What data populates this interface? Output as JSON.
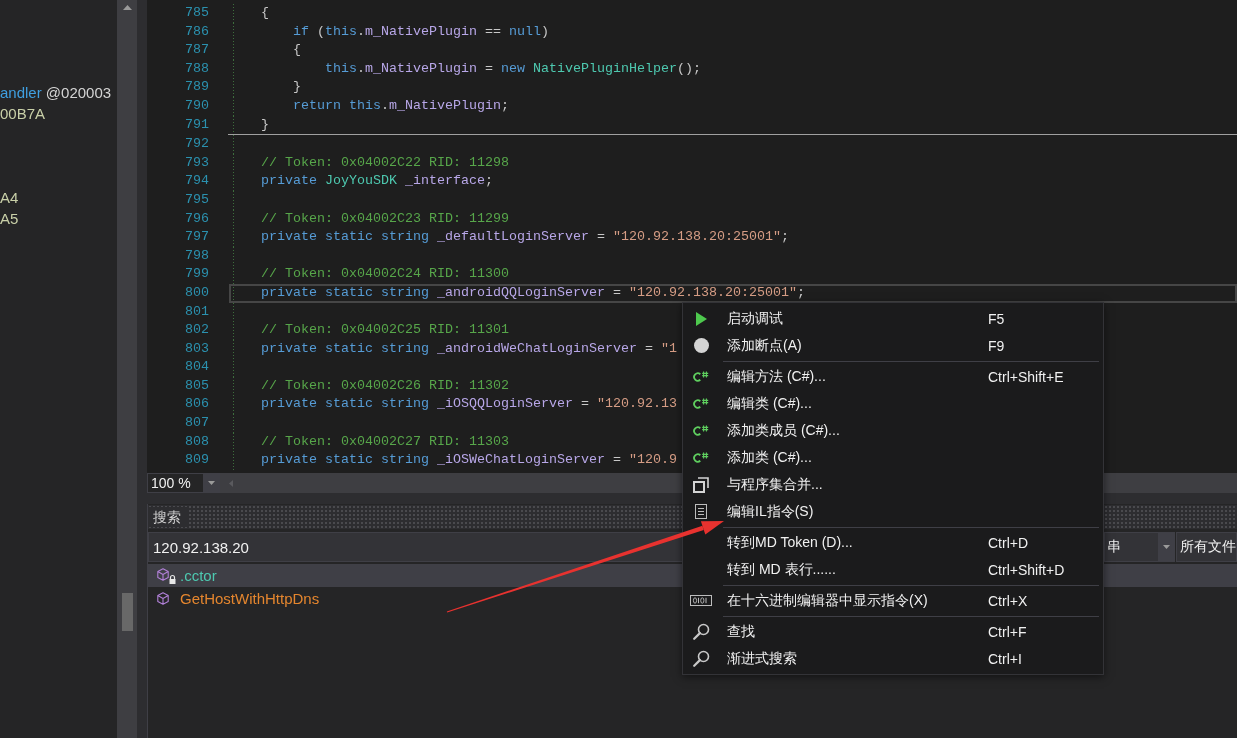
{
  "left_panel": {
    "groups": [
      [
        {
          "tokens": [
            {
              "kind": "name",
              "text": "andler"
            },
            {
              "kind": "plain",
              "text": " @020003"
            }
          ]
        },
        {
          "tokens": [
            {
              "kind": "number",
              "text": "00B7A"
            }
          ]
        }
      ],
      [
        {
          "tokens": [
            {
              "kind": "number",
              "text": "A4"
            }
          ]
        },
        {
          "tokens": [
            {
              "kind": "number",
              "text": "A5"
            }
          ]
        }
      ]
    ]
  },
  "editor": {
    "blocks": [
      [
        {
          "number": "785",
          "current": false,
          "tokens": [
            {
              "kind": "plain",
              "text": "    {"
            }
          ]
        },
        {
          "number": "786",
          "current": false,
          "tokens": [
            {
              "kind": "keyword",
              "text": "        if"
            },
            {
              "kind": "plain",
              "text": " ("
            },
            {
              "kind": "keyword",
              "text": "this"
            },
            {
              "kind": "plain",
              "text": "."
            },
            {
              "kind": "field",
              "text": "m_NativePlugin"
            },
            {
              "kind": "plain",
              "text": " == "
            },
            {
              "kind": "keyword",
              "text": "null"
            },
            {
              "kind": "plain",
              "text": ")"
            }
          ]
        },
        {
          "number": "787",
          "current": false,
          "tokens": [
            {
              "kind": "plain",
              "text": "        {"
            }
          ]
        },
        {
          "number": "788",
          "current": false,
          "tokens": [
            {
              "kind": "keyword",
              "text": "            this"
            },
            {
              "kind": "plain",
              "text": "."
            },
            {
              "kind": "field",
              "text": "m_NativePlugin"
            },
            {
              "kind": "plain",
              "text": " = "
            },
            {
              "kind": "keyword",
              "text": "new "
            },
            {
              "kind": "type",
              "text": "NativePluginHelper"
            },
            {
              "kind": "plain",
              "text": "();"
            }
          ]
        },
        {
          "number": "789",
          "current": false,
          "tokens": [
            {
              "kind": "plain",
              "text": "        }"
            }
          ]
        },
        {
          "number": "790",
          "current": false,
          "tokens": [
            {
              "kind": "keyword",
              "text": "        return this"
            },
            {
              "kind": "plain",
              "text": "."
            },
            {
              "kind": "field",
              "text": "m_NativePlugin"
            },
            {
              "kind": "plain",
              "text": ";"
            }
          ]
        },
        {
          "number": "791",
          "current": false,
          "tokens": [
            {
              "kind": "plain",
              "text": "    }"
            }
          ]
        }
      ],
      [
        {
          "number": "792",
          "current": false
        },
        {
          "number": "793",
          "current": false,
          "tokens": [
            {
              "kind": "comment",
              "text": "    // Token: 0x04002C22 RID: 11298"
            }
          ]
        },
        {
          "number": "794",
          "current": false,
          "tokens": [
            {
              "kind": "keyword",
              "text": "    private "
            },
            {
              "kind": "type",
              "text": "JoyYouSDK "
            },
            {
              "kind": "field",
              "text": "_interface"
            },
            {
              "kind": "plain",
              "text": ";"
            }
          ]
        },
        {
          "number": "795",
          "current": false
        },
        {
          "number": "796",
          "current": false,
          "tokens": [
            {
              "kind": "comment",
              "text": "    // Token: 0x04002C23 RID: 11299"
            }
          ]
        },
        {
          "number": "797",
          "current": false,
          "tokens": [
            {
              "kind": "keyword",
              "text": "    private static string "
            },
            {
              "kind": "field",
              "text": "_defaultLoginServer"
            },
            {
              "kind": "plain",
              "text": " = "
            },
            {
              "kind": "string",
              "text": "\"120.92.138.20:25001\""
            },
            {
              "kind": "plain",
              "text": ";"
            }
          ]
        },
        {
          "number": "798",
          "current": false
        },
        {
          "number": "799",
          "current": false,
          "tokens": [
            {
              "kind": "comment",
              "text": "    // Token: 0x04002C24 RID: 11300"
            }
          ]
        },
        {
          "number": "800",
          "current": true,
          "tokens": [
            {
              "kind": "keyword",
              "text": "    private static string "
            },
            {
              "kind": "field",
              "text": "_androidQQLoginServer"
            },
            {
              "kind": "plain",
              "text": " = "
            },
            {
              "kind": "string",
              "text": "\"120.92.138.20:25001\""
            },
            {
              "kind": "plain",
              "text": ";"
            }
          ]
        },
        {
          "number": "801",
          "current": false
        },
        {
          "number": "802",
          "current": false,
          "tokens": [
            {
              "kind": "comment",
              "text": "    // Token: 0x04002C25 RID: 11301"
            }
          ]
        },
        {
          "number": "803",
          "current": false,
          "tokens": [
            {
              "kind": "keyword",
              "text": "    private static string "
            },
            {
              "kind": "field",
              "text": "_androidWeChatLoginServer"
            },
            {
              "kind": "plain",
              "text": " = "
            },
            {
              "kind": "string",
              "text": "\"1"
            }
          ]
        },
        {
          "number": "804",
          "current": false
        },
        {
          "number": "805",
          "current": false,
          "tokens": [
            {
              "kind": "comment",
              "text": "    // Token: 0x04002C26 RID: 11302"
            }
          ]
        },
        {
          "number": "806",
          "current": false,
          "tokens": [
            {
              "kind": "keyword",
              "text": "    private static string "
            },
            {
              "kind": "field",
              "text": "_iOSQQLoginServer"
            },
            {
              "kind": "plain",
              "text": " = "
            },
            {
              "kind": "string",
              "text": "\"120.92.13"
            }
          ]
        },
        {
          "number": "807",
          "current": false
        },
        {
          "number": "808",
          "current": false,
          "tokens": [
            {
              "kind": "comment",
              "text": "    // Token: 0x04002C27 RID: 11303"
            }
          ]
        },
        {
          "number": "809",
          "current": false,
          "tokens": [
            {
              "kind": "keyword",
              "text": "    private static string "
            },
            {
              "kind": "field",
              "text": "_iOSWeChatLoginServer"
            },
            {
              "kind": "plain",
              "text": " = "
            },
            {
              "kind": "string",
              "text": "\"120.9"
            }
          ]
        }
      ]
    ],
    "zoom_level": "100 %"
  },
  "context_menu": {
    "groups": [
      [
        {
          "label": "启动调试",
          "shortcut": "F5"
        },
        {
          "label": "添加断点(A)",
          "shortcut": "F9"
        }
      ],
      [
        {
          "label": "编辑方法 (C#)...",
          "shortcut": "Ctrl+Shift+E"
        },
        {
          "label": "编辑类 (C#)..."
        },
        {
          "label": "添加类成员 (C#)..."
        },
        {
          "label": "添加类 (C#)..."
        },
        {
          "label": "与程序集合并..."
        },
        {
          "label": "编辑IL指令(S)"
        }
      ],
      [
        {
          "label": "转到MD Token (D)...",
          "shortcut": "Ctrl+D"
        },
        {
          "label": "转到 MD 表行......",
          "shortcut": "Ctrl+Shift+D"
        }
      ],
      [
        {
          "label": "在十六进制编辑器中显示指令(X)",
          "shortcut": "Ctrl+X"
        }
      ],
      [
        {
          "label": "查找",
          "shortcut": "Ctrl+F"
        },
        {
          "label": "渐进式搜索",
          "shortcut": "Ctrl+I"
        }
      ]
    ]
  },
  "search": {
    "title": "搜索",
    "query": "120.92.138.20",
    "dropdowns": [
      {
        "value": "串"
      },
      {
        "value": "所有文件"
      }
    ],
    "results": [
      {
        "kind": "constructor",
        "text": ".cctor",
        "selected": true
      },
      {
        "kind": "method",
        "text": "GetHostWithHttpDns",
        "selected": false
      }
    ]
  }
}
